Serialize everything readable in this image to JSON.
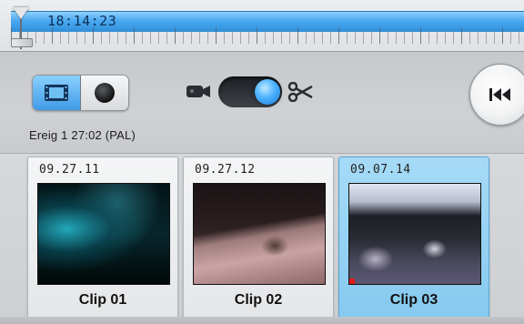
{
  "timeline": {
    "timecode": "18:14:23"
  },
  "toolbar": {
    "mode_buttons": [
      {
        "icon": "film-frame-icon",
        "selected": true
      },
      {
        "icon": "record-dot-icon",
        "selected": false
      }
    ],
    "toggle": {
      "left_icon": "camera-icon",
      "right_icon": "scissors-icon",
      "state": "right"
    },
    "rewind_icon": "rewind-to-start-icon",
    "event_info": "Ereig 1  27:02  (PAL)"
  },
  "clips": [
    {
      "date": "09.27.11",
      "name": "Clip 01",
      "selected": false
    },
    {
      "date": "09.27.12",
      "name": "Clip 02",
      "selected": false
    },
    {
      "date": "09.07.14",
      "name": "Clip 03",
      "selected": true
    }
  ],
  "colors": {
    "accent": "#4aa9f0",
    "selected_clip": "#86c9ef",
    "marker": "#e01b1b"
  }
}
